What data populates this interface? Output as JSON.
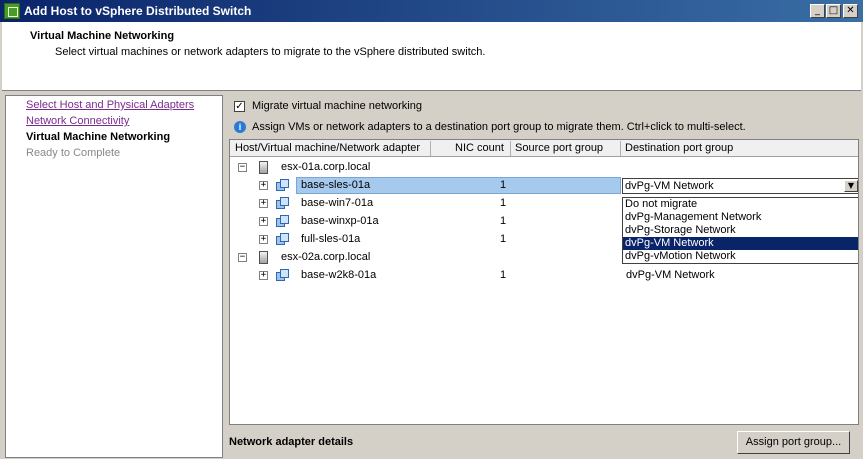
{
  "window": {
    "title": "Add Host to vSphere Distributed Switch",
    "controls": {
      "minimize": "_",
      "maximize": "□",
      "close": "✕"
    }
  },
  "header": {
    "title": "Virtual Machine Networking",
    "subtitle": "Select virtual machines or network adapters to migrate to the vSphere distributed switch."
  },
  "nav": {
    "items": [
      {
        "label": "Select Host and Physical Adapters",
        "state": "visited"
      },
      {
        "label": "Network Connectivity",
        "state": "visited"
      },
      {
        "label": "Virtual Machine Networking",
        "state": "current"
      },
      {
        "label": "Ready to Complete",
        "state": "future"
      }
    ]
  },
  "main": {
    "migrate_checkbox": {
      "label": "Migrate virtual machine networking",
      "checked": true,
      "mark": "✓"
    },
    "info_text": "Assign VMs or network adapters to a destination port group to migrate them. Ctrl+click to multi-select.",
    "info_icon": "i"
  },
  "grid": {
    "columns": [
      "Host/Virtual machine/Network adapter",
      "NIC count",
      "Source port group",
      "Destination port group"
    ],
    "rows": [
      {
        "type": "host",
        "name": "esx-01a.corp.local",
        "expander": "−"
      },
      {
        "type": "vm",
        "name": "base-sles-01a",
        "nic": "1",
        "source": "",
        "dest": "dvPg-VM Network",
        "selected": true,
        "expander": "+"
      },
      {
        "type": "vm",
        "name": "base-win7-01a",
        "nic": "1",
        "source": "",
        "dest": "",
        "expander": "+"
      },
      {
        "type": "vm",
        "name": "base-winxp-01a",
        "nic": "1",
        "source": "",
        "dest": "",
        "expander": "+"
      },
      {
        "type": "vm",
        "name": "full-sles-01a",
        "nic": "1",
        "source": "",
        "dest": "",
        "expander": "+"
      },
      {
        "type": "host",
        "name": "esx-02a.corp.local",
        "expander": "−"
      },
      {
        "type": "vm",
        "name": "base-w2k8-01a",
        "nic": "1",
        "source": "",
        "dest": "dvPg-VM Network",
        "expander": "+"
      }
    ]
  },
  "dropdown": {
    "value": "dvPg-VM Network",
    "arrow": "▼",
    "options": [
      "Do not migrate",
      "dvPg-Management Network",
      "dvPg-Storage Network",
      "dvPg-VM Network",
      "dvPg-vMotion Network"
    ],
    "selected_option": "dvPg-VM Network"
  },
  "footer": {
    "details_label": "Network adapter details",
    "assign_button": "Assign port group..."
  }
}
